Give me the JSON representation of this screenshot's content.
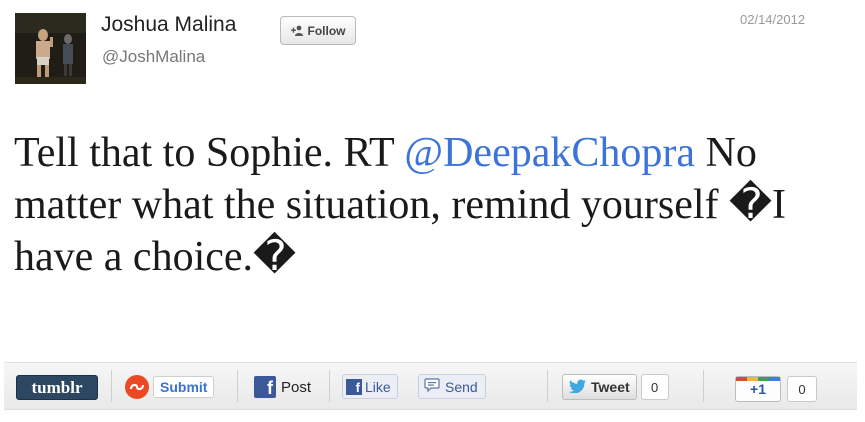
{
  "header": {
    "name": "Joshua Malina",
    "handle": "@JoshMalina",
    "follow_label": "Follow",
    "date": "02/14/2012"
  },
  "tweet": {
    "before_mention": "Tell that to Sophie. RT ",
    "mention": "@DeepakChopra",
    "after_mention": " No matter what the situation, remind yourself �I have a choice.�"
  },
  "sharebar": {
    "tumblr_label": "tumblr",
    "stumbleupon_label": "Submit",
    "facebook_post_label": "Post",
    "facebook_like_label": "Like",
    "facebook_send_label": "Send",
    "tweet_label": "Tweet",
    "tweet_count": "0",
    "gplus_label": "+1",
    "gplus_count": "0"
  },
  "colors": {
    "mention": "#3b73d8",
    "tumblr_bg": "#2c4762",
    "facebook_blue": "#3b5998",
    "stumbleupon_red": "#eb4924"
  },
  "icons": [
    "user-add-icon",
    "stumbleupon-icon",
    "facebook-icon",
    "speech-bubble-icon",
    "twitter-bird-icon"
  ]
}
